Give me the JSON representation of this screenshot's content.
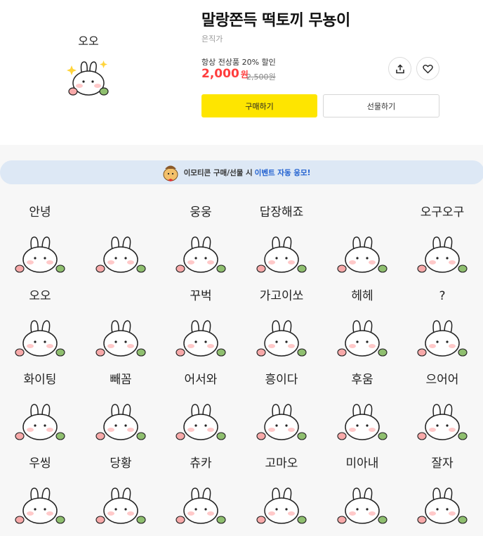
{
  "product": {
    "title": "말랑쫀득 떡토끼 무뇽이",
    "author": "은직가",
    "promo": "항상 전상품 20% 할인",
    "price": "2,000",
    "currency": "원",
    "original_price": "2,500원",
    "buy_label": "구매하기",
    "gift_label": "선물하기",
    "thumbnail_caption": "오오",
    "share_icon": "share-icon",
    "like_icon": "heart-icon"
  },
  "banner": {
    "text": "이모티콘 구매/선물 시",
    "highlight": "이벤트 자동 응모!"
  },
  "stickers": [
    {
      "caption": "안녕"
    },
    {
      "caption": ""
    },
    {
      "caption": "웅웅"
    },
    {
      "caption": "답장해죠"
    },
    {
      "caption": ""
    },
    {
      "caption": "오구오구"
    },
    {
      "caption": "오오"
    },
    {
      "caption": ""
    },
    {
      "caption": "꾸벅"
    },
    {
      "caption": "가고이쏘"
    },
    {
      "caption": "헤헤"
    },
    {
      "caption": "?"
    },
    {
      "caption": "화이팅"
    },
    {
      "caption": "빼꼼"
    },
    {
      "caption": "어서와"
    },
    {
      "caption": "흥이다"
    },
    {
      "caption": "후움"
    },
    {
      "caption": "으어어"
    },
    {
      "caption": "우씽"
    },
    {
      "caption": "당황"
    },
    {
      "caption": "츄카"
    },
    {
      "caption": "고마오"
    },
    {
      "caption": "미아내"
    },
    {
      "caption": "잘자"
    }
  ],
  "colors": {
    "buy_yellow": "#fee500",
    "price_red": "#ff3d3d",
    "banner_bg": "#dde8f5",
    "banner_highlight": "#2060d0"
  }
}
